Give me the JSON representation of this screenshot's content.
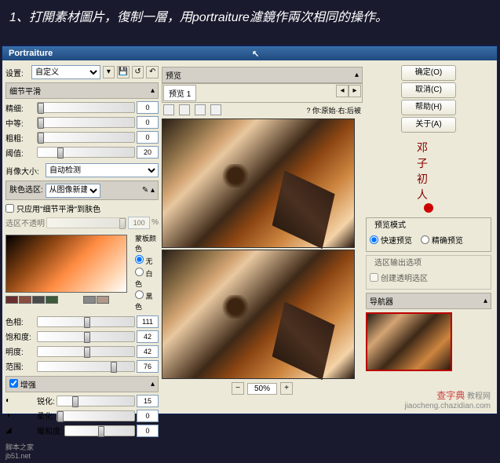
{
  "instruction": "1、打開素材圖片，復制一層，用portraiture濾鏡作兩次相同的操作。",
  "window_title": "Portraiture",
  "settings_label": "设置:",
  "settings_value": "自定义",
  "sections": {
    "detail_smooth": "细节平滑",
    "skin_tone": "肤色选区:",
    "enhance": "增强"
  },
  "sliders": {
    "fine": "精细:",
    "fine_val": "0",
    "medium": "中等:",
    "medium_val": "0",
    "coarse": "粗粗:",
    "coarse_val": "0",
    "threshold": "阈值:",
    "threshold_val": "20",
    "portrait_size": "肖像大小:",
    "portrait_size_val": "自动检测",
    "skin_src": "从图像新建",
    "apply_only": "只应用\"细节平滑\"到肤色",
    "opacity": "选区不透明",
    "opacity_val": "100",
    "opacity_pct": "%",
    "hue": "色相:",
    "hue_val": "111",
    "sat": "饱和度:",
    "sat_val": "42",
    "lum": "明度:",
    "lum_val": "42",
    "range": "范围:",
    "range_val": "76",
    "sharpen": "锐化:",
    "sharpen_val": "15",
    "soften": "柔化:",
    "soften_val": "0",
    "warmth": "暖和度:",
    "warmth_val": "0"
  },
  "mask_colors": {
    "title": "蒙板颜色",
    "none": "无",
    "white": "白色",
    "black": "黑色"
  },
  "preview": {
    "title": "预览",
    "tab": "预览 1",
    "info": "?  你:原始·右:后被",
    "zoom": "50%"
  },
  "buttons": {
    "ok": "确定(O)",
    "cancel": "取消(C)",
    "help": "帮助(H)",
    "about": "关于(A)"
  },
  "right_panel": {
    "preview_mode": "预览模式",
    "fast": "快速预览",
    "precise": "精确预览",
    "output": "选区输出选项",
    "create_alpha": "创建透明选区",
    "navigator": "导航器"
  },
  "watermarks": {
    "left": "脚本之家\njb51.net",
    "right_top": "查字典",
    "right_bottom": "jiaocheng.chazidian.com"
  }
}
